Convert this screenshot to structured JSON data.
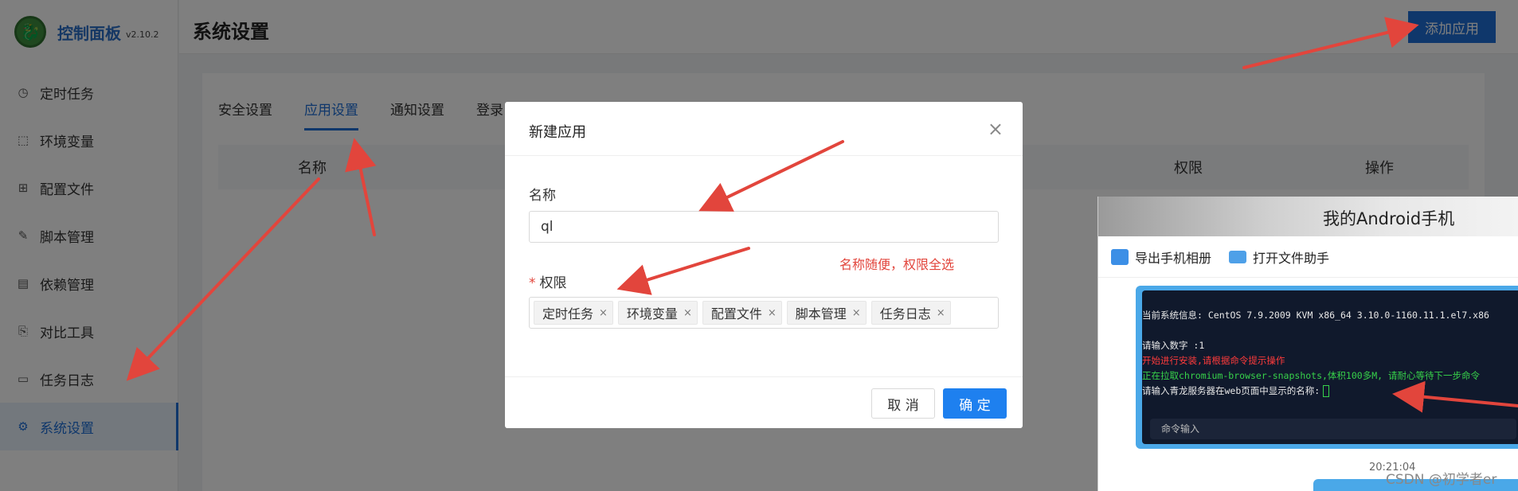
{
  "sidebar": {
    "brand_title": "控制面板",
    "version": "v2.10.2",
    "items": [
      {
        "label": "定时任务",
        "icon": "clock-icon",
        "glyph": "◷"
      },
      {
        "label": "环境变量",
        "icon": "variable-icon",
        "glyph": "⬚"
      },
      {
        "label": "配置文件",
        "icon": "config-icon",
        "glyph": "⊞"
      },
      {
        "label": "脚本管理",
        "icon": "edit-icon",
        "glyph": "✎"
      },
      {
        "label": "依赖管理",
        "icon": "package-icon",
        "glyph": "▤"
      },
      {
        "label": "对比工具",
        "icon": "diff-icon",
        "glyph": "⎘"
      },
      {
        "label": "任务日志",
        "icon": "folder-icon",
        "glyph": "▭"
      },
      {
        "label": "系统设置",
        "icon": "gear-icon",
        "glyph": "⚙"
      }
    ],
    "active_index": 7
  },
  "header": {
    "title": "系统设置",
    "add_button": "添加应用"
  },
  "tabs": [
    {
      "label": "安全设置"
    },
    {
      "label": "应用设置"
    },
    {
      "label": "通知设置"
    },
    {
      "label": "登录"
    }
  ],
  "active_tab": 1,
  "table": {
    "columns": [
      "名称",
      "权限",
      "操作"
    ]
  },
  "modal": {
    "title": "新建应用",
    "close_glyph": "×",
    "name_label": "名称",
    "name_value": "ql",
    "perm_required_mark": "*",
    "perm_label": "权限",
    "note": "名称随便，权限全选",
    "tags": [
      "定时任务",
      "环境变量",
      "配置文件",
      "脚本管理",
      "任务日志"
    ],
    "tag_close_glyph": "×",
    "cancel": "取 消",
    "ok": "确 定"
  },
  "phone": {
    "title": "我的Android手机",
    "toolbar": [
      "导出手机相册",
      "打开文件助手"
    ],
    "terminal": {
      "line1": "当前系统信息: CentOS 7.9.2009 KVM x86_64 3.10.0-1160.11.1.el7.x86",
      "line2": "请输入数字 :1",
      "line3": "开始进行安装,请根据命令提示操作",
      "line4": "正在拉取chromium-browser-snapshots,体积100多M, 请耐心等待下一步命令",
      "line5": "请输入青龙服务器在web页面中显示的名称:",
      "input_placeholder": "命令输入"
    },
    "time": "20:21:04"
  },
  "watermark": "CSDN @初学者er",
  "colors": {
    "primary": "#1e6fd6",
    "annotation_red": "#e2453c"
  }
}
